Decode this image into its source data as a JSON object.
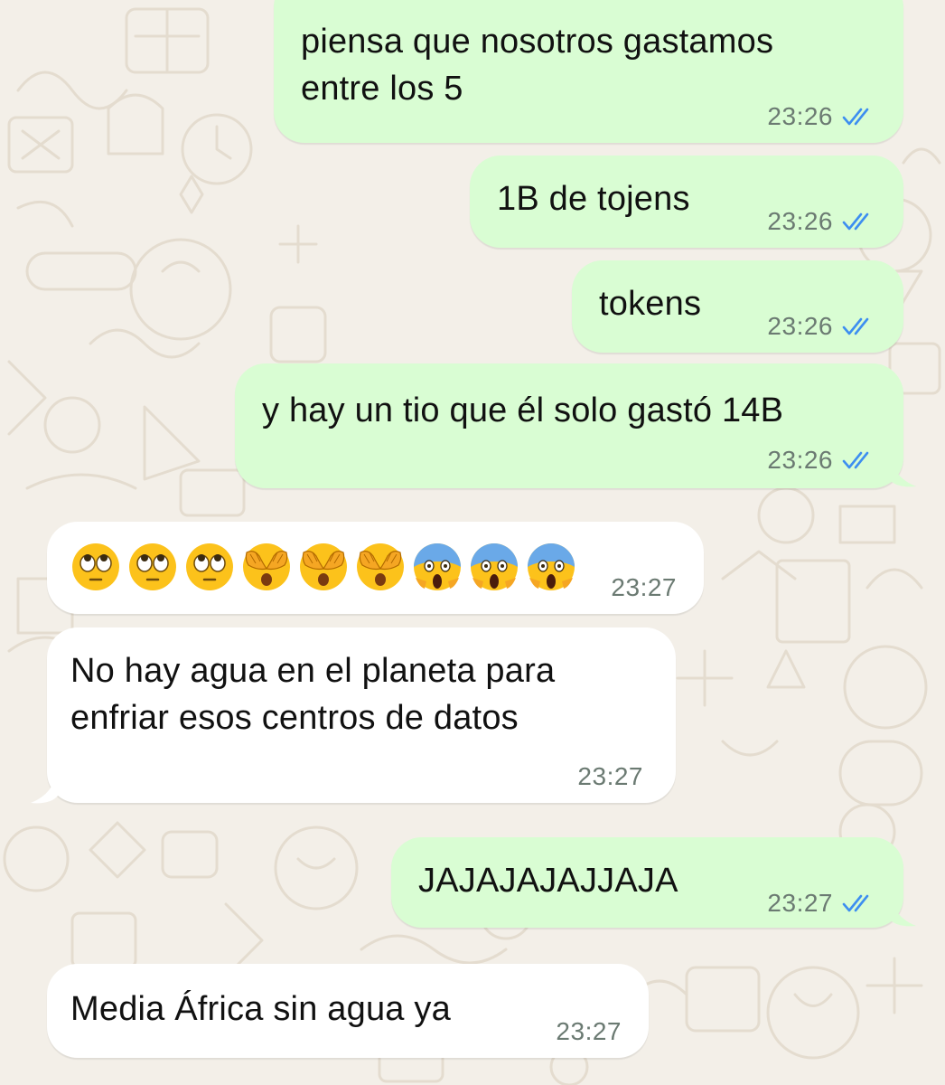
{
  "conversation": {
    "messages": [
      {
        "direction": "outgoing",
        "text": "piensa que nosotros gastamos\nentre los 5",
        "time": "23:26",
        "status": "read"
      },
      {
        "direction": "outgoing",
        "text": "1B de tojens",
        "time": "23:26",
        "status": "read"
      },
      {
        "direction": "outgoing",
        "text": "tokens",
        "time": "23:26",
        "status": "read"
      },
      {
        "direction": "outgoing",
        "text": "y hay un tio que él solo gastó 14B",
        "time": "23:26",
        "status": "read"
      },
      {
        "direction": "incoming",
        "emojis": [
          "face-with-rolling-eyes",
          "face-with-rolling-eyes",
          "face-with-rolling-eyes",
          "see-no-evil-face",
          "see-no-evil-face",
          "see-no-evil-face",
          "face-screaming-in-fear",
          "face-screaming-in-fear",
          "face-screaming-in-fear"
        ],
        "time": "23:27"
      },
      {
        "direction": "incoming",
        "text": "No hay agua en el planeta para\nenfriar esos centros de datos",
        "time": "23:27"
      },
      {
        "direction": "outgoing",
        "text": "JAJAJAJAJJAJA",
        "time": "23:27",
        "status": "read"
      },
      {
        "direction": "incoming",
        "text": "Media África sin agua ya",
        "time": "23:27"
      }
    ]
  },
  "colors": {
    "wallpaper": "#f3efe8",
    "outgoing_bubble": "#d9fdd3",
    "incoming_bubble": "#ffffff",
    "read_ticks": "#3d8ef0",
    "timestamp": "#6b7a72"
  },
  "icons": {
    "read_receipt": "double-check-icon"
  }
}
